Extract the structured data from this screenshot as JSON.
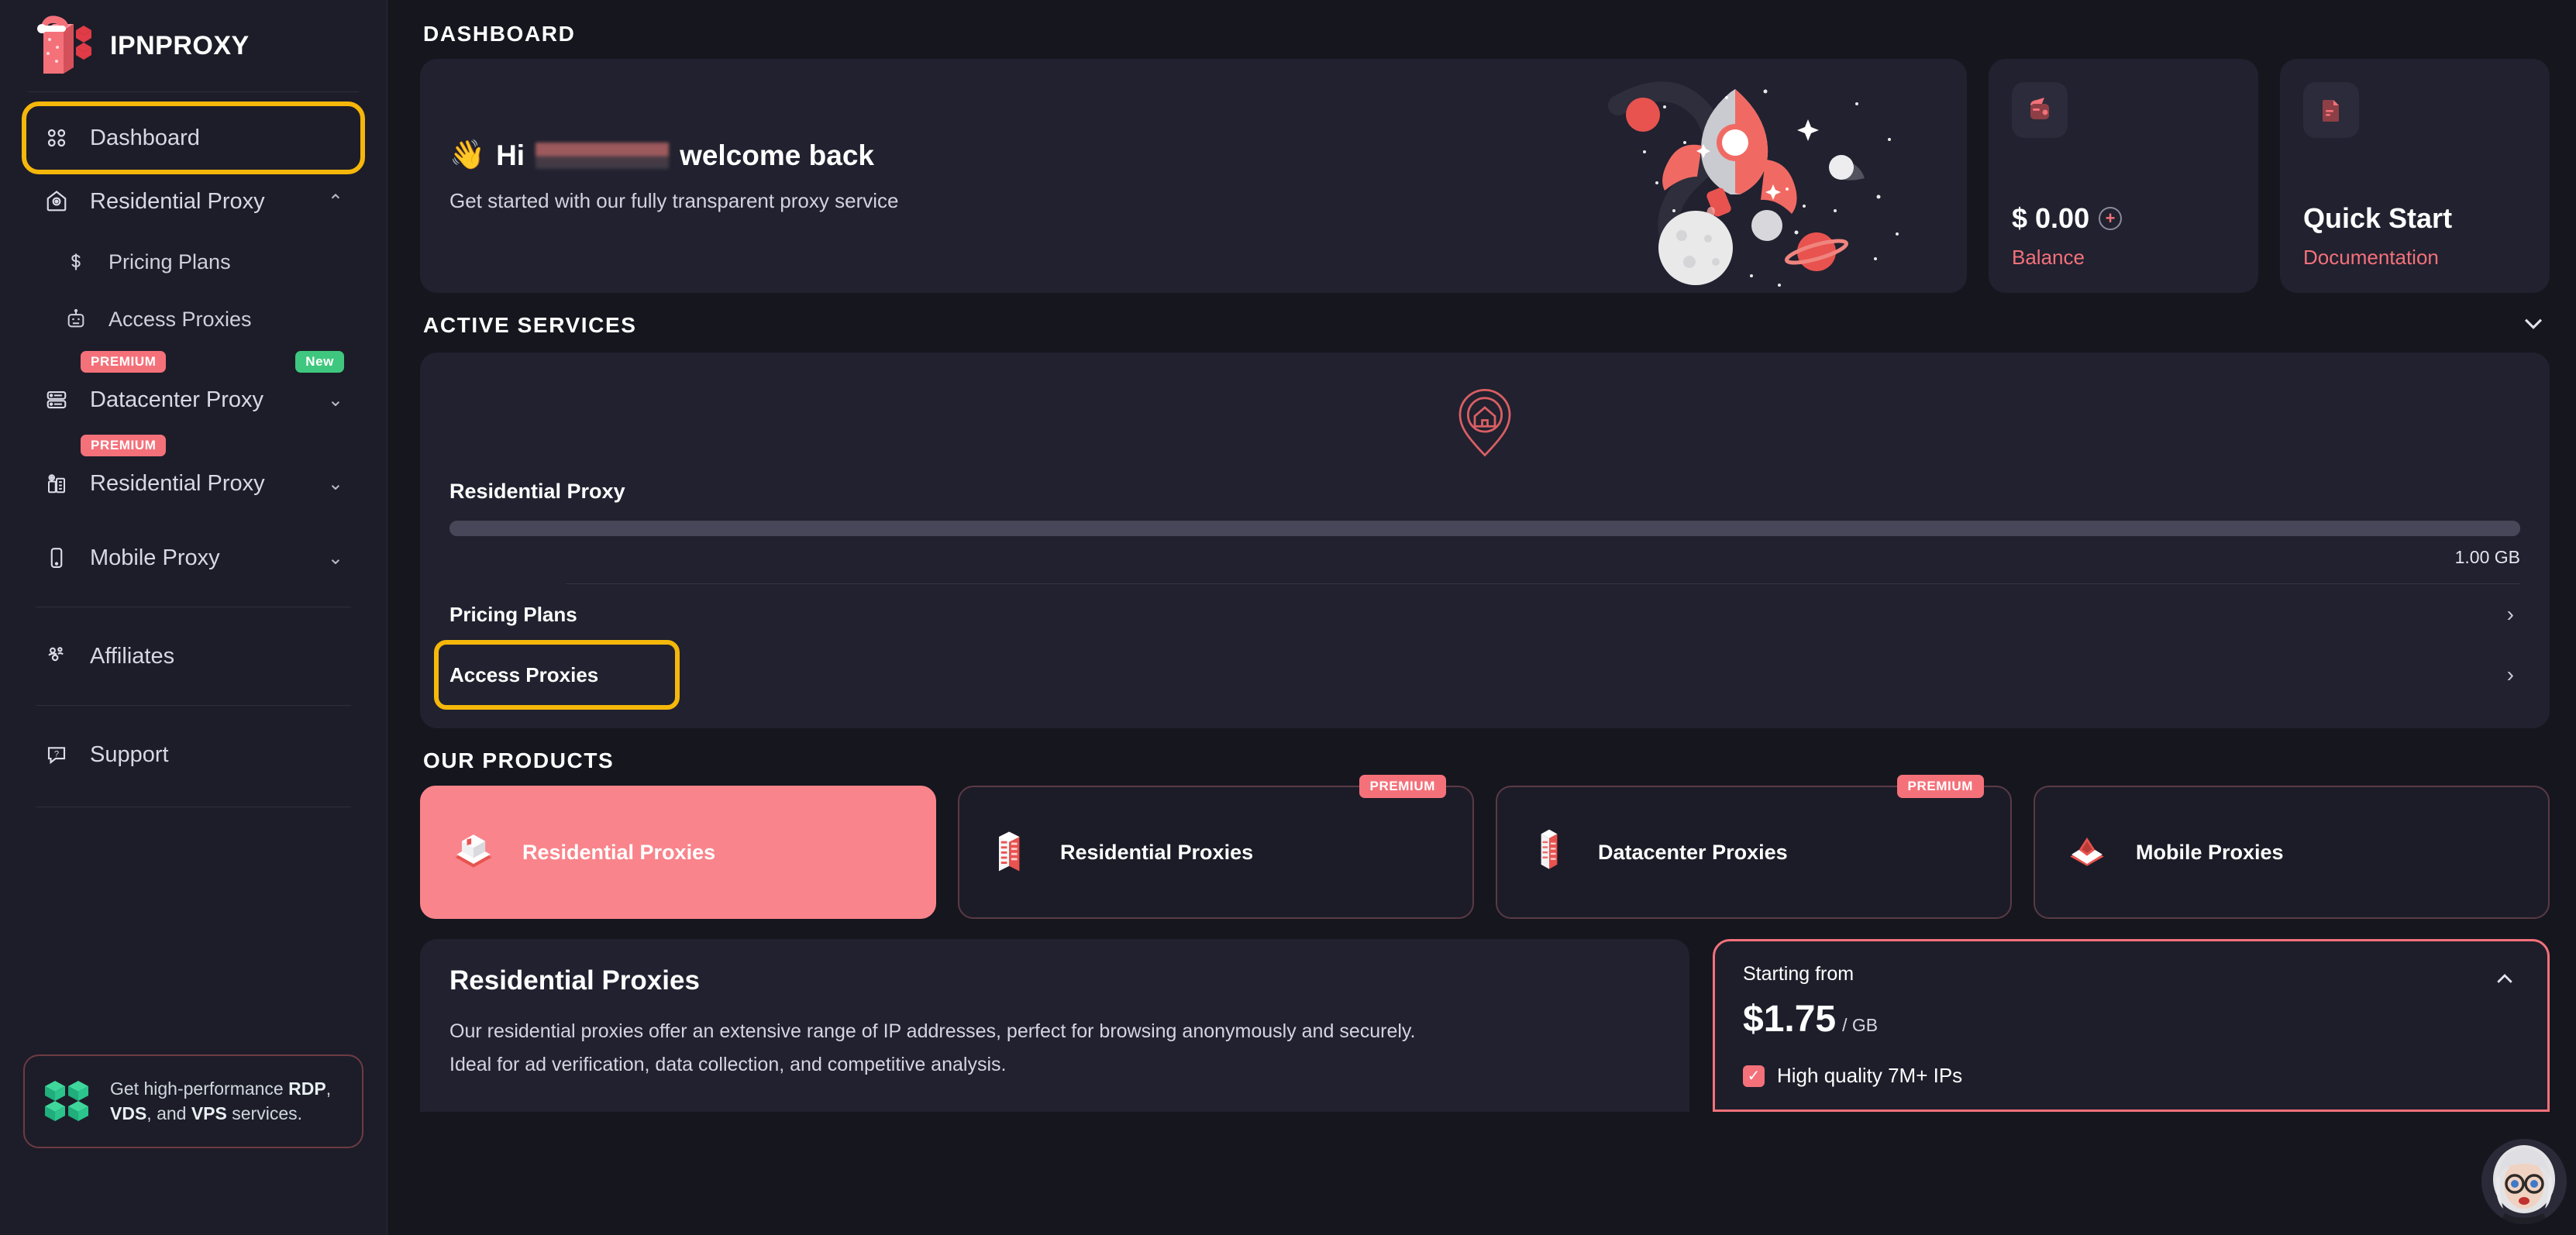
{
  "brand": {
    "name": "IPNPROXY",
    "logo_icon": "santa-hat-proxy-logo"
  },
  "sidebar": {
    "items": [
      {
        "label": "Dashboard",
        "icon": "grid-dashboard-icon",
        "highlighted": true
      },
      {
        "label": "Residential Proxy",
        "icon": "home-pin-icon",
        "chevron": "⌃"
      },
      {
        "label": "Pricing Plans",
        "icon": "dollar-icon",
        "sub": true
      },
      {
        "label": "Access Proxies",
        "icon": "robot-icon",
        "sub": true
      },
      {
        "label": "Datacenter Proxy",
        "icon": "server-rack-icon",
        "chevron": "⌄",
        "badge_premium": "PREMIUM",
        "badge_new": "New"
      },
      {
        "label": "Residential Proxy",
        "icon": "building-pin-icon",
        "chevron": "⌄",
        "badge_premium": "PREMIUM"
      },
      {
        "label": "Mobile Proxy",
        "icon": "mobile-phone-icon",
        "chevron": "⌄"
      },
      {
        "label": "Affiliates",
        "icon": "people-group-icon"
      },
      {
        "label": "Support",
        "icon": "question-chat-icon"
      }
    ],
    "promo": {
      "icon": "green-cubes-icon",
      "line1": "Get high-performance",
      "b1": "RDP",
      "sep1": ", ",
      "b2": "VDS",
      "sep2": ", and ",
      "b3": "VPS",
      "line3": "services."
    }
  },
  "main": {
    "dashboard_title": "DASHBOARD",
    "hero": {
      "greeting_prefix": "Hi",
      "greeting_suffix": "welcome back",
      "wave_icon": "waving-hand-emoji",
      "subtitle": "Get started with our fully transparent proxy service",
      "illustration": "rocket-space-illustration"
    },
    "balance_card": {
      "icon": "wallet-icon",
      "value": "$ 0.00",
      "label": "Balance",
      "add_icon": "plus-circle-icon"
    },
    "quickstart_card": {
      "icon": "document-icon",
      "title": "Quick Start",
      "label": "Documentation"
    },
    "active_services": {
      "title": "ACTIVE SERVICES",
      "collapse_icon": "chevron-down-icon",
      "illustration": "home-location-pin-icon",
      "service_name": "Residential Proxy",
      "usage_value": "1.00 GB",
      "usage_percent": 100,
      "rows": [
        {
          "label": "Pricing Plans",
          "chevron": "›",
          "highlighted": false
        },
        {
          "label": "Access Proxies",
          "chevron": "›",
          "highlighted": true
        }
      ]
    },
    "our_products": {
      "title": "OUR PRODUCTS",
      "cards": [
        {
          "label": "Residential Proxies",
          "icon": "house-isometric-icon",
          "selected": true,
          "badge": ""
        },
        {
          "label": "Residential Proxies",
          "icon": "apartment-isometric-icon",
          "selected": false,
          "badge": "PREMIUM"
        },
        {
          "label": "Datacenter Proxies",
          "icon": "server-isometric-icon",
          "selected": false,
          "badge": "PREMIUM"
        },
        {
          "label": "Mobile Proxies",
          "icon": "mobile-isometric-icon",
          "selected": false,
          "badge": ""
        }
      ]
    },
    "detail": {
      "title": "Residential Proxies",
      "desc_line1": "Our residential proxies offer an extensive range of IP addresses, perfect for browsing anonymously and securely.",
      "desc_line2": "Ideal for ad verification, data collection, and competitive analysis.",
      "starting_from_label": "Starting from",
      "price": "$1.75",
      "price_unit": "/ GB",
      "collapse_icon": "chevron-up-icon",
      "feature": "High quality 7M+ IPs",
      "check_icon": "check-icon"
    },
    "chatbot": {
      "icon": "support-agent-avatar"
    }
  },
  "colors": {
    "accent": "#f4717a",
    "highlight": "#f5b70a",
    "green": "#3fc77f",
    "card_bg": "#21212f",
    "page_bg": "#16161f",
    "sidebar_bg": "#1d1d29"
  }
}
